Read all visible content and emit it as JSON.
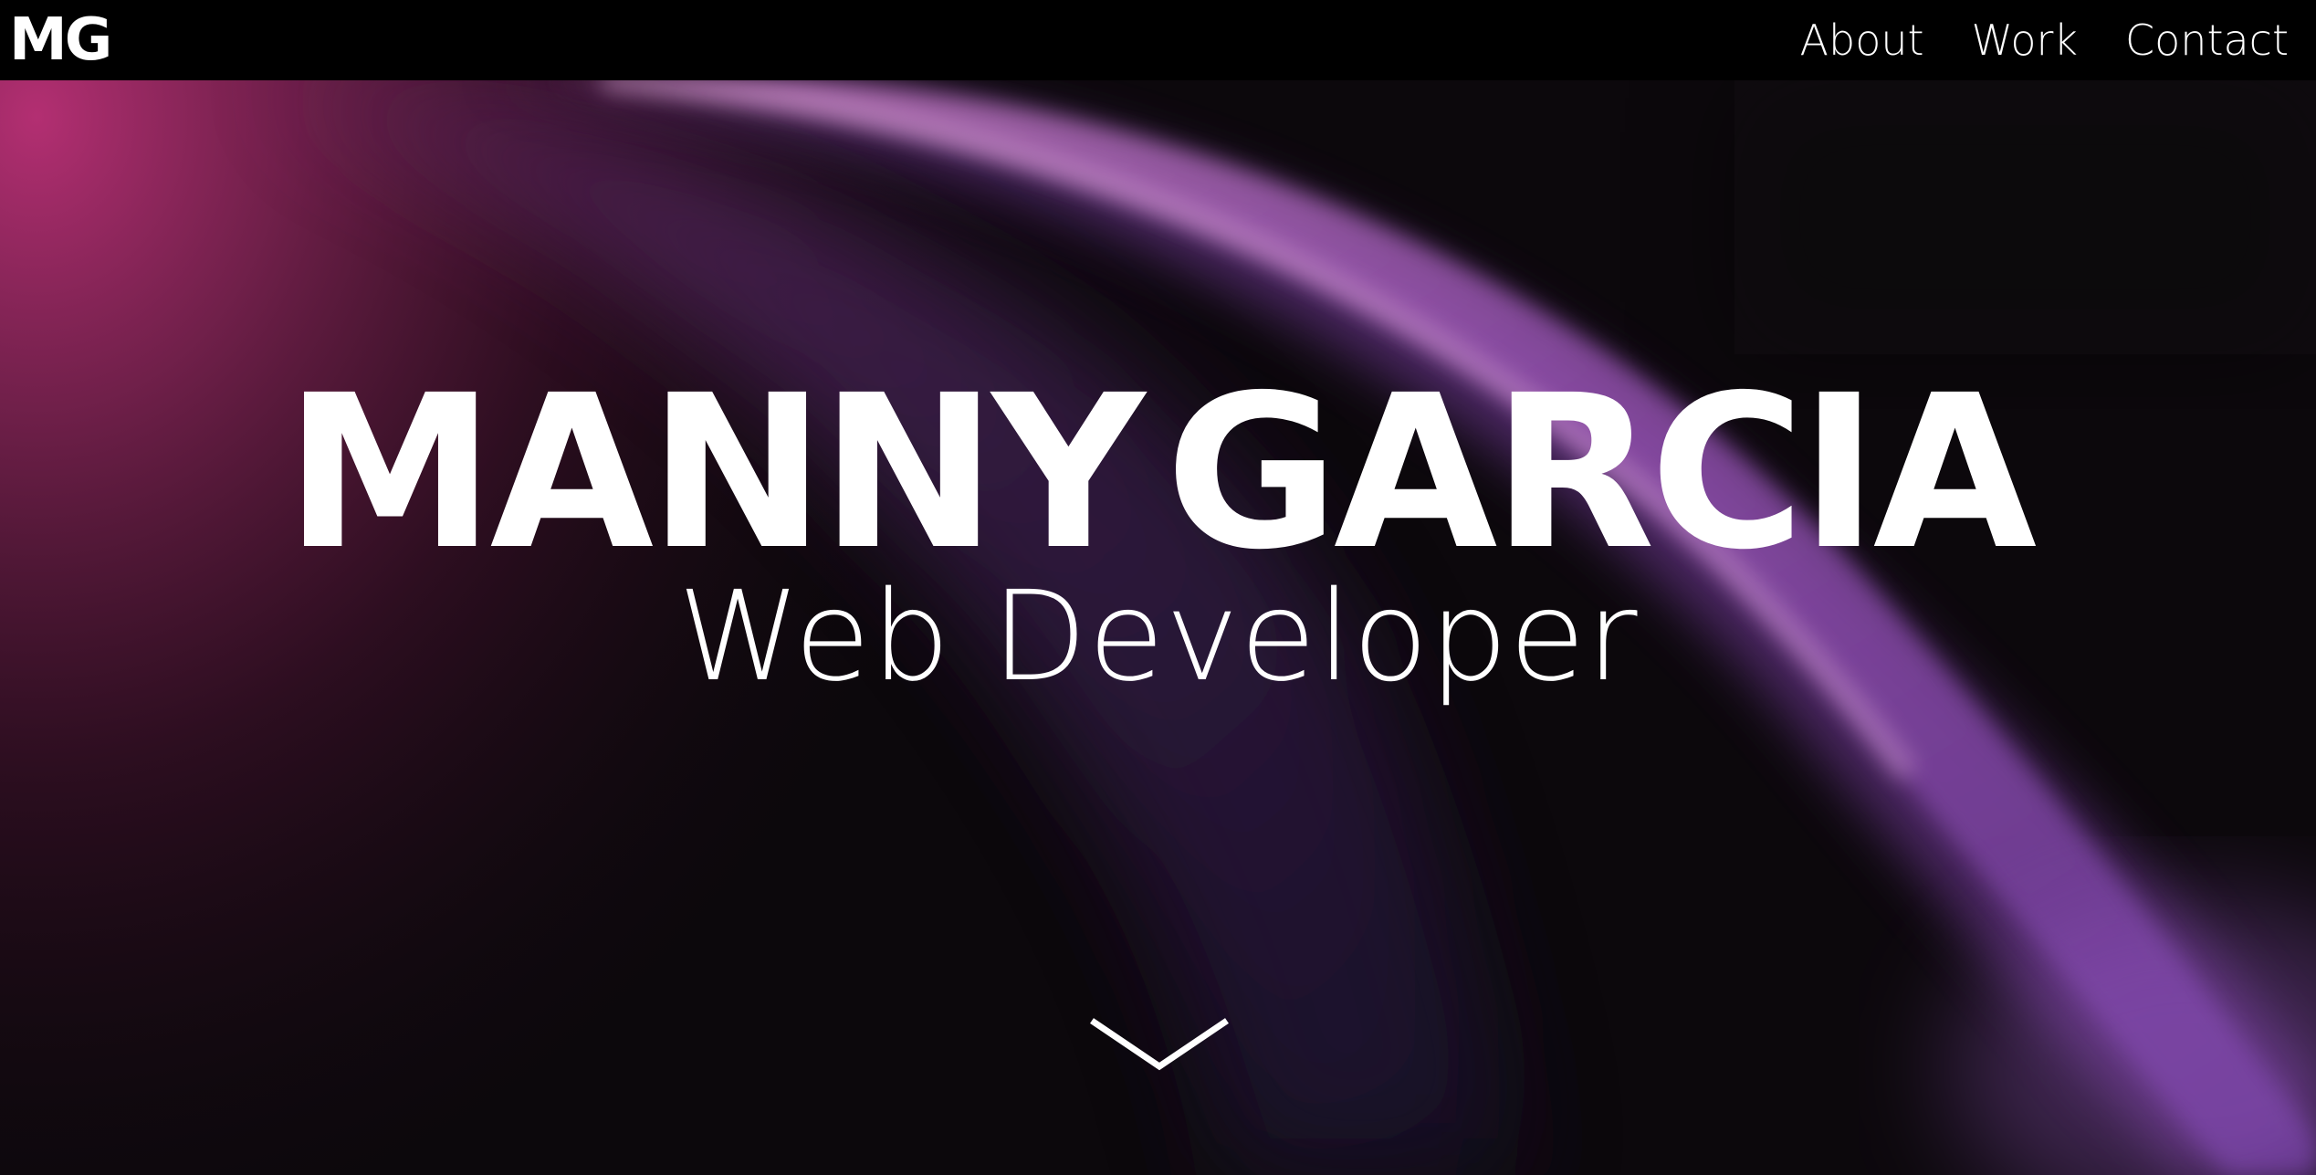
{
  "header": {
    "logo": "MG",
    "nav": [
      {
        "label": "About"
      },
      {
        "label": "Work"
      },
      {
        "label": "Contact"
      }
    ]
  },
  "hero": {
    "name_first": "MANNY",
    "name_last": "GARCIA",
    "role": "Web Developer",
    "scroll_icon": "chevron-down-icon"
  },
  "colors": {
    "background": "#0c080c",
    "navbar": "#000000",
    "text": "#ffffff",
    "accent_magenta": "#b0306e",
    "accent_purple": "#9a5bc8"
  }
}
